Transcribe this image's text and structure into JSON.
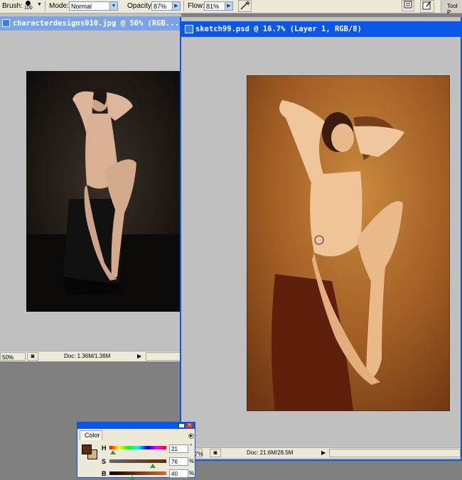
{
  "options_bar": {
    "brush_label": "Brush:",
    "brush_size": "100",
    "mode_label": "Mode:",
    "mode_value": "Normal",
    "opacity_label": "Opacity:",
    "opacity_value": "87%",
    "flow_label": "Flow:",
    "flow_value": "81%",
    "tool_presets_label": "Tool P"
  },
  "doc1": {
    "title": "characterdesigns010.jpg @ 50% (RGB...",
    "zoom": "50%",
    "doc_size": "Doc: 1.36M/1.36M"
  },
  "doc2": {
    "title": "sketch99.psd @ 16.7% (Layer 1, RGB/8)",
    "zoom": "7%",
    "doc_size": "Doc: 21.6M/28.5M"
  },
  "color_panel": {
    "tab": "Color",
    "h_label": "H",
    "h_value": "21",
    "h_unit": "°",
    "s_label": "S",
    "s_value": "76",
    "s_unit": "%",
    "b_label": "B",
    "b_value": "40",
    "b_unit": "%",
    "foreground": "#5a2d12",
    "background": "#d9b27a"
  },
  "colors": {
    "titlebar_active": "#0a56e8",
    "canvas_gray": "#c0c0c0",
    "ui_face": "#ece9d8"
  },
  "icons": [
    "brush-preset-icon",
    "dropdown-arrow-icon",
    "airbrush-icon",
    "palette-well-icon",
    "tool-presets-icon",
    "window-control-icon",
    "close-icon"
  ]
}
